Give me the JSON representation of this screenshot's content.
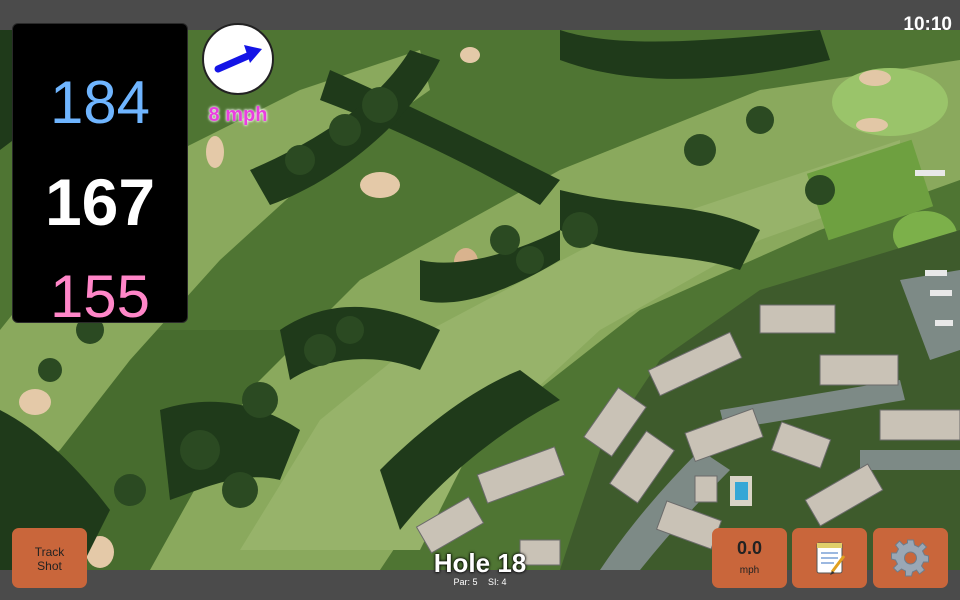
{
  "status_bar": {
    "time": "10:10"
  },
  "distances": {
    "back": "184",
    "middle": "167",
    "front": "155"
  },
  "wind": {
    "icon": "wind-arrow-icon",
    "label": "8 mph"
  },
  "buttons": {
    "track_shot": [
      "Track",
      "Shot"
    ],
    "speed_value": "0.0",
    "speed_unit": "mph",
    "notes_icon": "notepad-icon",
    "settings_icon": "gear-icon"
  },
  "hole": {
    "title": "Hole 18",
    "par": "Par: 5",
    "si": "SI: 4"
  },
  "colors": {
    "back": "#6fb5ff",
    "middle": "#ffffff",
    "front": "#ff86c8",
    "wind": "#ea3fe0",
    "button": "#c9663b"
  }
}
